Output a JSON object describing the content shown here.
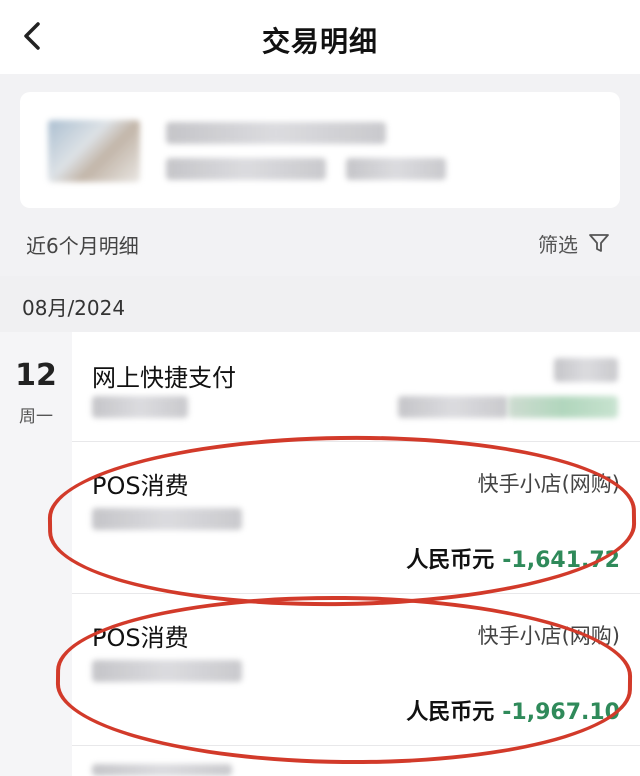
{
  "header": {
    "title": "交易明细"
  },
  "filter_row": {
    "range_label": "近6个月明细",
    "filter_label": "筛选"
  },
  "month": {
    "label": "08月/2024"
  },
  "day": {
    "number": "12",
    "weekday": "周一"
  },
  "transactions": [
    {
      "title": "网上快捷支付"
    },
    {
      "title": "POS消费",
      "merchant": "快手小店(网购)",
      "currency": "人民币元",
      "amount": "-1,641.72"
    },
    {
      "title": "POS消费",
      "merchant": "快手小店(网购)",
      "currency": "人民币元",
      "amount": "-1,967.10"
    }
  ],
  "colors": {
    "amount_negative": "#2f8a5a",
    "annotation": "#d23a2a",
    "background": "#f2f2f4"
  },
  "icons": {
    "back": "chevron-left-icon",
    "filter": "funnel-icon"
  }
}
